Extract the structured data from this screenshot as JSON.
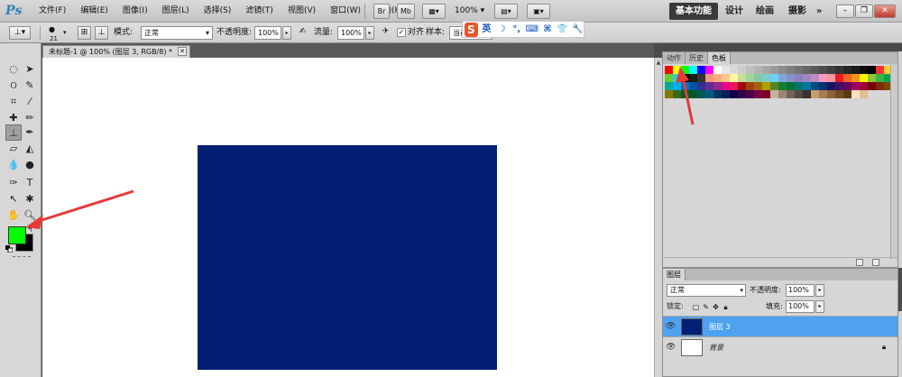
{
  "app": {
    "logo": "Ps"
  },
  "menu": [
    "文件(F)",
    "编辑(E)",
    "图像(I)",
    "图层(L)",
    "选择(S)",
    "滤镜(T)",
    "视图(V)",
    "窗口(W)",
    "帮助(H)"
  ],
  "menubar": {
    "bridge_label": "Br",
    "minibridge_label": "Mb",
    "zoom": "100%",
    "workspaces": {
      "essentials": "基本功能",
      "design": "设计",
      "painting": "绘画",
      "photography": "摄影",
      "more": "»"
    },
    "window_controls": {
      "minimize": "–",
      "restore": "❐",
      "close": "✕"
    }
  },
  "options": {
    "brush_size": "21",
    "mode_label": "模式:",
    "mode_value": "正常",
    "opacity_label": "不透明度:",
    "opacity_value": "100%",
    "flow_label": "流量:",
    "flow_value": "100%",
    "align_label": "对齐",
    "sample_label": "样本:",
    "sample_value": "当前"
  },
  "ime": {
    "logo": "S",
    "lang": "英",
    "items": [
      "☽",
      "°,",
      "⌨",
      "⌘",
      "👕",
      "🔧"
    ]
  },
  "document": {
    "tab_title": "未标题-1 @ 100% (图层 3, RGB/8) *",
    "tab_close": "✕"
  },
  "canvas": {
    "fill_color": "#021f73",
    "background": "#ffffff"
  },
  "colors": {
    "foreground": "#00ff00",
    "background": "#000000"
  },
  "swatches_panel": {
    "tabs": [
      "动作",
      "历史",
      "色板"
    ],
    "active_tab": 2,
    "colors": [
      "#ff0000",
      "#ffff00",
      "#00ff00",
      "#00ffff",
      "#0000ff",
      "#ff00ff",
      "#ffffff",
      "#e6e6e6",
      "#d9d9d9",
      "#cccccc",
      "#bfbfbf",
      "#b3b3b3",
      "#a6a6a6",
      "#999999",
      "#8c8c8c",
      "#808080",
      "#737373",
      "#666666",
      "#595959",
      "#4d4d4d",
      "#404040",
      "#333333",
      "#262626",
      "#1a1a1a",
      "#0d0d0d",
      "#000000",
      "#ff3333",
      "#ffcc33",
      "#66cc33",
      "#33cccc",
      "#000000",
      "#1a1a1a",
      "#333333",
      "#f7977a",
      "#f9ad81",
      "#fdc68a",
      "#fff79a",
      "#c4df9b",
      "#a3d39c",
      "#82ca9d",
      "#7bcdc8",
      "#6ecff6",
      "#7ea7d8",
      "#8493ca",
      "#8882be",
      "#a187be",
      "#bc8dbf",
      "#f49ac2",
      "#f6989d",
      "#ed1c24",
      "#f26522",
      "#f7941d",
      "#fff200",
      "#8dc73f",
      "#39b54a",
      "#00a651",
      "#00a99d",
      "#00aeef",
      "#0072bc",
      "#0054a6",
      "#2e3192",
      "#662d91",
      "#92278f",
      "#ec008c",
      "#ed145b",
      "#9e0b0f",
      "#a0410d",
      "#a36209",
      "#aba000",
      "#598527",
      "#197b30",
      "#007236",
      "#00746b",
      "#0076a3",
      "#004b80",
      "#003471",
      "#1b1464",
      "#440e62",
      "#630460",
      "#9e005d",
      "#9e0039",
      "#790000",
      "#7b2e00",
      "#7d4900",
      "#827b00",
      "#406618",
      "#005e20",
      "#005826",
      "#005952",
      "#005b7f",
      "#003663",
      "#002157",
      "#0d004c",
      "#32004b",
      "#4b0049",
      "#7b0046",
      "#7a0026",
      "#c7b299",
      "#998675",
      "#736357",
      "#534741",
      "#37302d",
      "#c69c6d",
      "#a67c52",
      "#8c6239",
      "#754c24",
      "#603913",
      "#f5e1c6",
      "#e0c08f"
    ]
  },
  "layers_panel": {
    "tab": "图层",
    "blend_mode": "正常",
    "opacity_label": "不透明度:",
    "opacity_value": "100%",
    "lock_label": "锁定:",
    "fill_label": "填充:",
    "fill_value": "100%",
    "layers": [
      {
        "name": "图层 3",
        "selected": true,
        "thumb_color": "#021f73"
      },
      {
        "name": "背景",
        "selected": false,
        "thumb_color": "#ffffff"
      }
    ]
  },
  "arrow_color": "#e63a3a"
}
